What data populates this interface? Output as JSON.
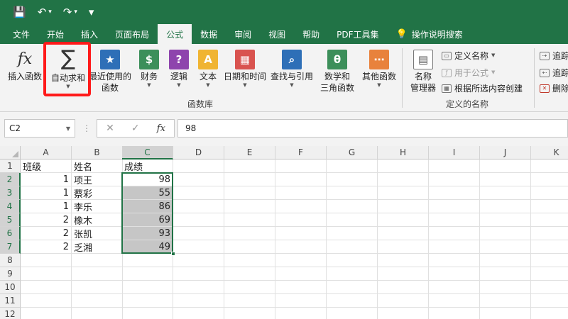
{
  "quick_access": {
    "save": "💾",
    "undo": "↶",
    "redo": "↷",
    "customize": "▾"
  },
  "tabs": [
    "文件",
    "开始",
    "插入",
    "页面布局",
    "公式",
    "数据",
    "审阅",
    "视图",
    "帮助",
    "PDF工具集"
  ],
  "active_tab": "公式",
  "tell_me": "操作说明搜索",
  "ribbon": {
    "insert_function": "插入函数",
    "autosum": "自动求和",
    "recent_line1": "最近使用的",
    "recent_line2": "函数",
    "financial": "财务",
    "logical": "逻辑",
    "text": "文本",
    "datetime": "日期和时间",
    "lookup": "查找与引用",
    "math_line1": "数学和",
    "math_line2": "三角函数",
    "other": "其他函数",
    "library_label": "函数库",
    "name_manager_line1": "名称",
    "name_manager_line2": "管理器",
    "define_name": "定义名称",
    "use_in_formula": "用于公式",
    "create_from_selection": "根据所选内容创建",
    "defined_names_label": "定义的名称",
    "trace_precedents": "追踪",
    "trace_dependents": "追踪",
    "remove_arrows": "删除"
  },
  "formula_bar": {
    "name_box": "C2",
    "fx": "fx",
    "value": "98"
  },
  "columns": [
    "A",
    "B",
    "C",
    "D",
    "E",
    "F",
    "G",
    "H",
    "I",
    "J",
    "K"
  ],
  "rows": [
    "1",
    "2",
    "3",
    "4",
    "5",
    "6",
    "7",
    "8",
    "9",
    "10",
    "11",
    "12"
  ],
  "table": {
    "headers": [
      "班级",
      "姓名",
      "成绩"
    ],
    "data": [
      [
        "1",
        "项王",
        "98"
      ],
      [
        "1",
        "蔡彩",
        "55"
      ],
      [
        "1",
        "李乐",
        "86"
      ],
      [
        "2",
        "橡木",
        "69"
      ],
      [
        "2",
        "张凯",
        "93"
      ],
      [
        "2",
        "乏湘",
        "49"
      ]
    ]
  },
  "colors": {
    "accent": "#217346",
    "highlight": "#ff1a1a",
    "selection_fill": "#c6c6c6"
  }
}
